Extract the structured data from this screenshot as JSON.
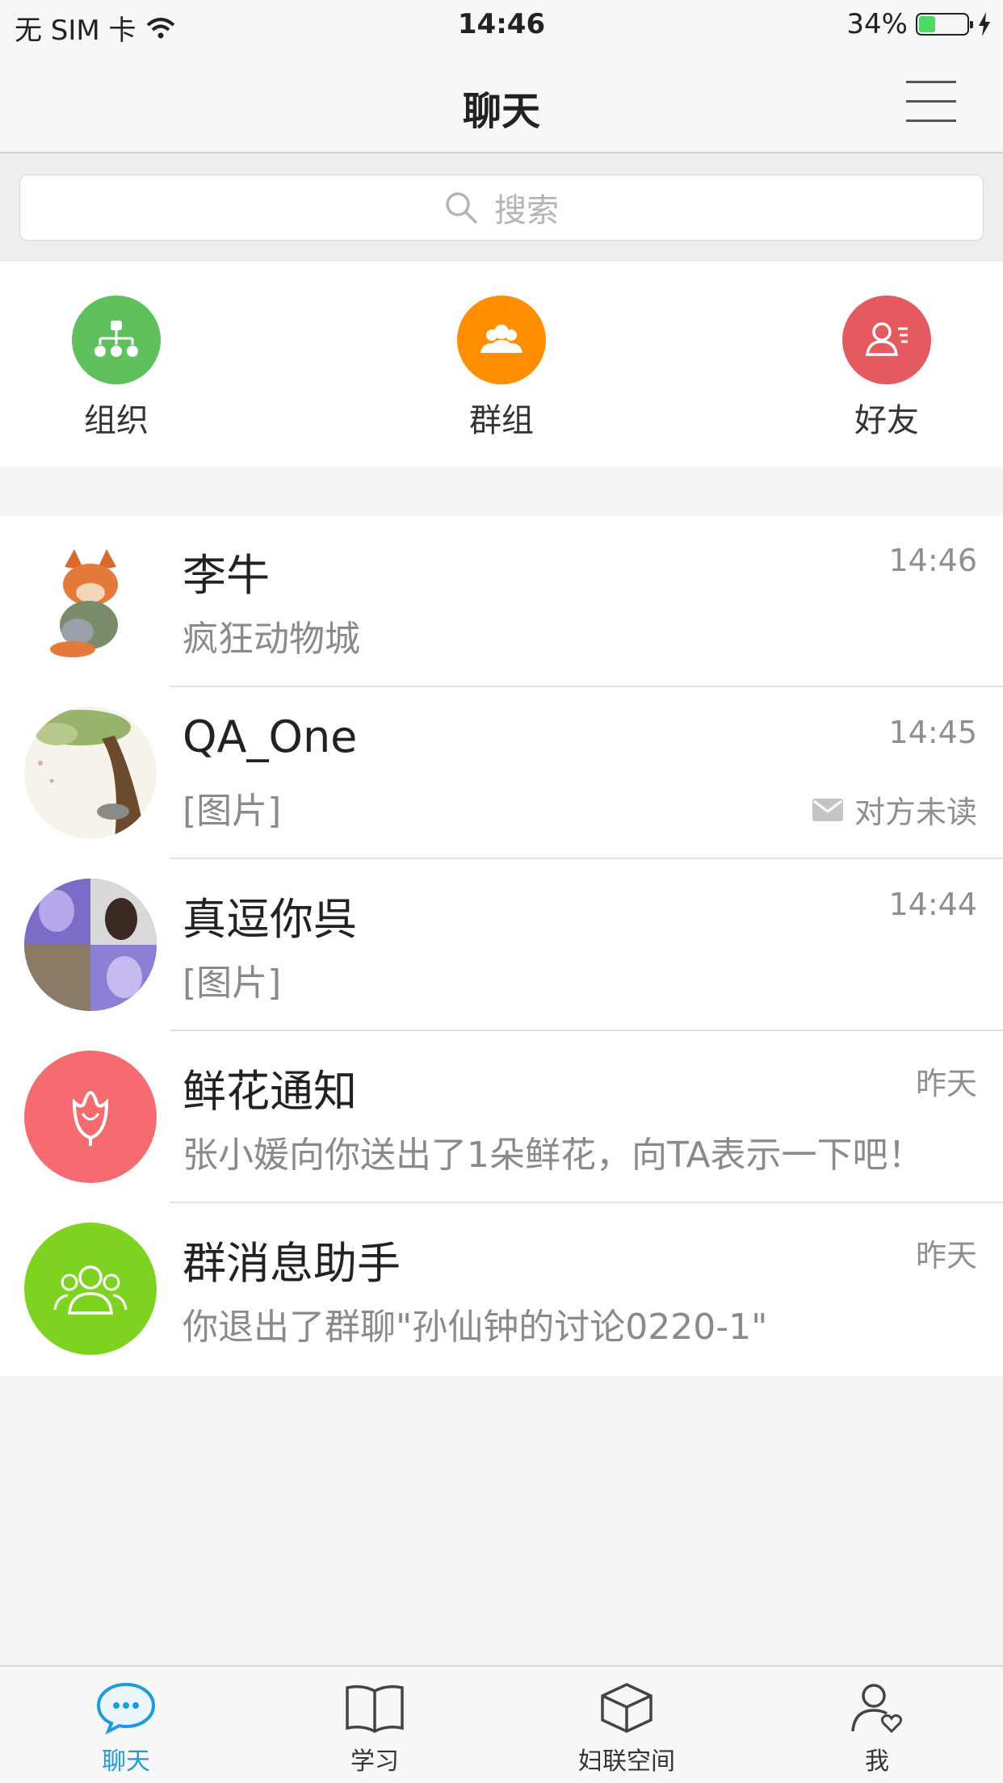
{
  "status_bar": {
    "carrier": "无 SIM 卡",
    "time": "14:46",
    "battery": "34%",
    "battery_level": 0.34
  },
  "nav": {
    "title": "聊天"
  },
  "search": {
    "placeholder": "搜索"
  },
  "shortcuts": [
    {
      "label": "组织",
      "icon": "org-chart-icon",
      "color": "#5ec15e"
    },
    {
      "label": "群组",
      "icon": "group-icon",
      "color": "#ff8f00"
    },
    {
      "label": "好友",
      "icon": "friend-icon",
      "color": "#e45a5e"
    }
  ],
  "chats": [
    {
      "name": "李牛",
      "time": "14:46",
      "message": "疯狂动物城",
      "status": ""
    },
    {
      "name": "QA_One",
      "time": "14:45",
      "message": "[图片]",
      "status": "对方未读"
    },
    {
      "name": "真逗你呉",
      "time": "14:44",
      "message": "[图片]",
      "status": ""
    },
    {
      "name": "鲜花通知",
      "time": "昨天",
      "message": "张小媛向你送出了1朵鲜花，向TA表示一下吧！",
      "status": "",
      "avatar_color": "#f66b6f"
    },
    {
      "name": "群消息助手",
      "time": "昨天",
      "message": "你退出了群聊\"孙仙钟的讨论0220-1\"",
      "status": "",
      "avatar_color": "#7ed321"
    }
  ],
  "tabs": [
    {
      "label": "聊天",
      "icon": "chat-bubble-icon",
      "active": true
    },
    {
      "label": "学习",
      "icon": "book-icon",
      "active": false
    },
    {
      "label": "妇联空间",
      "icon": "cube-icon",
      "active": false
    },
    {
      "label": "我",
      "icon": "person-heart-icon",
      "active": false
    }
  ],
  "colors": {
    "accent": "#1d9be0",
    "background": "#f4f4f6"
  }
}
